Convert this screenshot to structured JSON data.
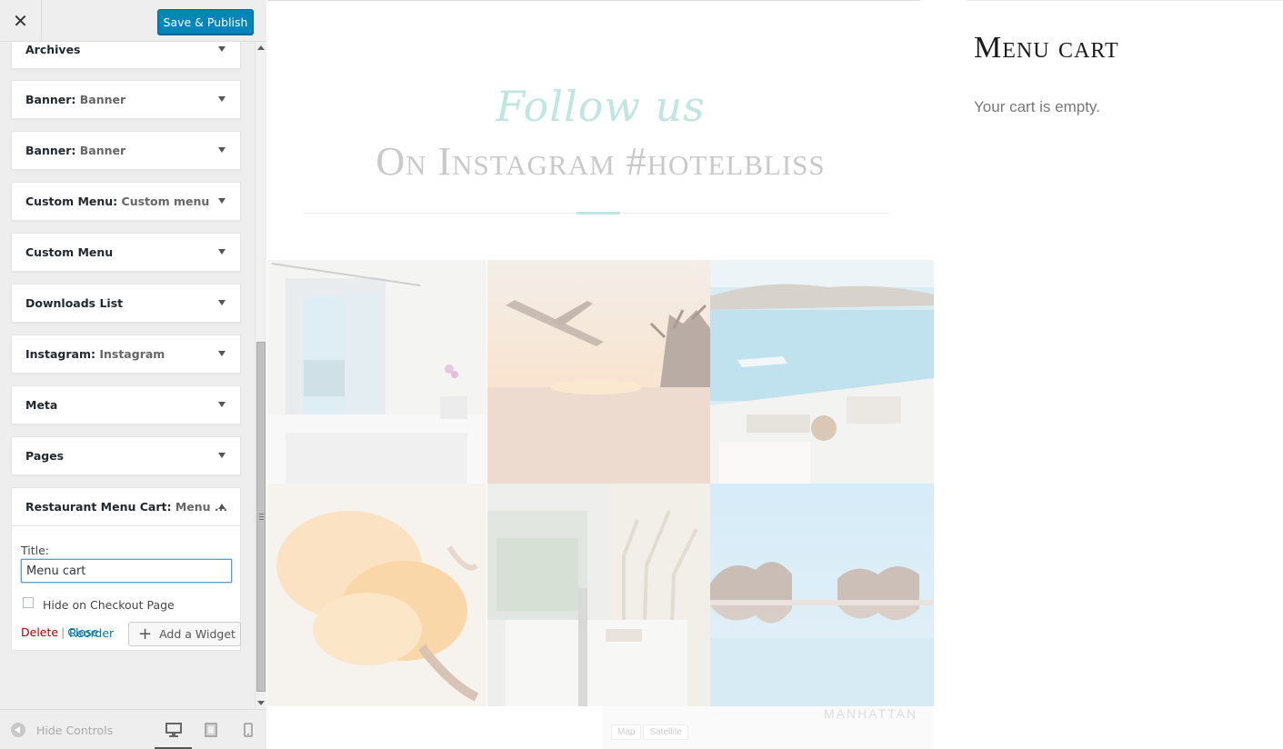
{
  "header": {
    "close_icon": "close-icon",
    "save_label": "Save & Publish"
  },
  "widgets": [
    {
      "name": "Archives",
      "sub": ""
    },
    {
      "name": "Banner",
      "sub": "Banner"
    },
    {
      "name": "Banner",
      "sub": "Banner"
    },
    {
      "name": "Custom Menu",
      "sub": "Custom menu"
    },
    {
      "name": "Custom Menu",
      "sub": ""
    },
    {
      "name": "Downloads List",
      "sub": ""
    },
    {
      "name": "Instagram",
      "sub": "Instagram"
    },
    {
      "name": "Meta",
      "sub": ""
    },
    {
      "name": "Pages",
      "sub": ""
    }
  ],
  "open_widget": {
    "name": "Restaurant Menu Cart",
    "sub": "Menu ...",
    "title_label": "Title:",
    "title_value": "Menu cart",
    "checkbox_label": "Hide on Checkout Page",
    "checkbox_checked": false,
    "delete_label": "Delete",
    "separator": "|",
    "close_label": "Close"
  },
  "panel_actions": {
    "reorder_label": "Reorder",
    "add_widget_label": "Add a Widget"
  },
  "footer": {
    "hide_controls_label": "Hide Controls",
    "devices": [
      "desktop-icon",
      "tablet-icon",
      "mobile-icon"
    ],
    "active_device": "desktop"
  },
  "preview": {
    "follow_text": "Follow us",
    "instagram_heading": "On Instagram #hotelbliss",
    "accent_color": "#bfe6e1",
    "photos": [
      "bedroom-balcony",
      "airplane-sunset",
      "santorini-cruise",
      "food-closeup",
      "hotel-room",
      "infinity-pool"
    ],
    "map_tabs": [
      "Map",
      "Satellite"
    ],
    "map_city": "MANHATTAN"
  },
  "sidebar": {
    "title": "Menu cart",
    "text": "Your cart is empty."
  },
  "colors": {
    "primary_button": "#0085ba",
    "link": "#0073aa",
    "delete": "#aa0000",
    "panel_bg": "#eeeeee"
  }
}
